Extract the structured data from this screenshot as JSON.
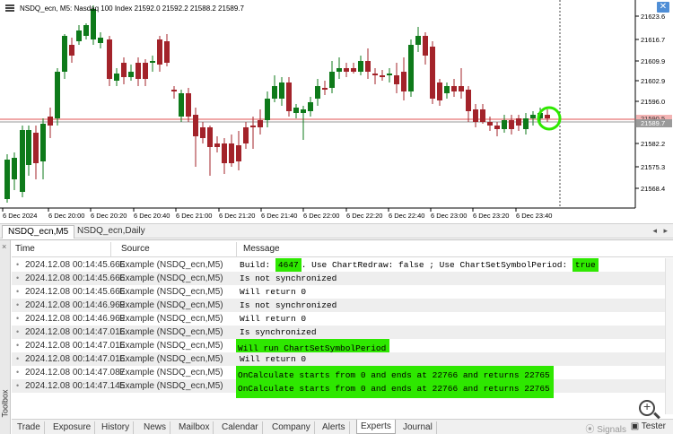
{
  "chart": {
    "title": "NSDQ_ecn, M5:  Nasdaq 100 Index  21592.0 21592.2 21588.2 21589.7",
    "price_labels": [
      "21623.6",
      "21616.7",
      "21609.9",
      "21602.9",
      "21596.0",
      "21589.7",
      "21582.2",
      "21575.3",
      "21568.4"
    ],
    "current_price_label": "21589.7",
    "prev_price_label": "21590.5",
    "time_labels": [
      "6 Dec 2024",
      "6 Dec 20:00",
      "6 Dec 20:20",
      "6 Dec 20:40",
      "6 Dec 21:00",
      "6 Dec 21:20",
      "6 Dec 21:40",
      "6 Dec 22:00",
      "6 Dec 22:20",
      "6 Dec 22:40",
      "6 Dec 23:00",
      "6 Dec 23:20",
      "6 Dec 23:40"
    ],
    "colors": {
      "bull": "#0e7a1a",
      "bear": "#a3232a",
      "price_line": "#e05050",
      "highlight": "#2ee800"
    }
  },
  "chart_tabs": [
    {
      "label": "NSDQ_ecn,M5"
    },
    {
      "label": "NSDQ_ecn,Daily"
    }
  ],
  "log": {
    "columns": {
      "time": "Time",
      "source": "Source",
      "message": "Message"
    },
    "rows": [
      {
        "time": "2024.12.08 00:14:45.666",
        "source": "Example (NSDQ_ecn,M5)",
        "msg_pre": "Build: ",
        "msg_hl1": "4647",
        "msg_mid": ". Use ChartRedraw: false ; Use ChartSetSymbolPeriod: ",
        "msg_hl2": "true"
      },
      {
        "time": "2024.12.08 00:14:45.666",
        "source": "Example (NSDQ_ecn,M5)",
        "msg": "Is not synchronized"
      },
      {
        "time": "2024.12.08 00:14:45.666",
        "source": "Example (NSDQ_ecn,M5)",
        "msg": "Will return 0"
      },
      {
        "time": "2024.12.08 00:14:46.969",
        "source": "Example (NSDQ_ecn,M5)",
        "msg": "Is not synchronized"
      },
      {
        "time": "2024.12.08 00:14:46.969",
        "source": "Example (NSDQ_ecn,M5)",
        "msg": "Will return 0"
      },
      {
        "time": "2024.12.08 00:14:47.016",
        "source": "Example (NSDQ_ecn,M5)",
        "msg": "Is synchronized"
      },
      {
        "time": "2024.12.08 00:14:47.016",
        "source": "Example (NSDQ_ecn,M5)",
        "msg": "Will run ChartSetSymbolPeriod",
        "highlight": true
      },
      {
        "time": "2024.12.08 00:14:47.016",
        "source": "Example (NSDQ_ecn,M5)",
        "msg": "Will return 0"
      },
      {
        "time": "2024.12.08 00:14:47.087",
        "source": "Example (NSDQ_ecn,M5)",
        "msg": "OnCalculate starts from 0 and ends at 22766 and returns 22765",
        "highlight": true
      },
      {
        "time": "2024.12.08 00:14:47.145",
        "source": "Example (NSDQ_ecn,M5)",
        "msg": "OnCalculate starts from 0 and ends at 22766 and returns 22765",
        "highlight": true
      }
    ]
  },
  "toolbox": {
    "label": "Toolbox",
    "close": "×"
  },
  "bottom_tabs": [
    "Trade",
    "Exposure",
    "History",
    "News",
    "Mailbox",
    "Calendar",
    "Company",
    "Alerts",
    "Experts",
    "Journal"
  ],
  "active_bottom_tab": "Experts",
  "signals_label": "Signals",
  "tester_label": "Tester"
}
